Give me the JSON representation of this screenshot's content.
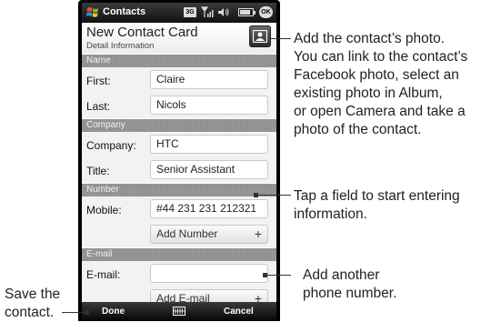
{
  "statusbar": {
    "app_title": "Contacts",
    "network_badge": "3G",
    "ok_label": "OK"
  },
  "header": {
    "title": "New Contact Card",
    "subtitle": "Detail Information"
  },
  "sections": {
    "name": "Name",
    "company": "Company",
    "number": "Number",
    "email": "E-mail"
  },
  "fields": {
    "first": {
      "label": "First:",
      "value": "Claire"
    },
    "last": {
      "label": "Last:",
      "value": "Nicols"
    },
    "company": {
      "label": "Company:",
      "value": "HTC"
    },
    "title": {
      "label": "Title:",
      "value": "Senior Assistant"
    },
    "mobile": {
      "label": "Mobile:",
      "value": "#44 231 231 212321"
    },
    "add_number": {
      "label": "Add Number"
    },
    "email": {
      "label": "E-mail:",
      "value": ""
    },
    "add_email": {
      "label": "Add E-mail"
    }
  },
  "softkeys": {
    "left": "Done",
    "right": "Cancel"
  },
  "callouts": {
    "photo": [
      "Add the contact’s photo.",
      "You can link to the contact’s",
      "Facebook photo, select an",
      "existing photo in Album,",
      "or open Camera and take a",
      "photo of the contact."
    ],
    "field": [
      "Tap a field to start entering",
      "information."
    ],
    "another": [
      "Add another",
      "phone number."
    ],
    "save": [
      "Save the",
      "contact."
    ]
  },
  "icons": {
    "windows": "windows-logo-icon",
    "signal": "signal-icon",
    "speaker": "speaker-icon",
    "battery": "battery-icon",
    "photo": "contact-photo-icon",
    "keyboard": "keyboard-icon",
    "plus": "plus-icon"
  }
}
